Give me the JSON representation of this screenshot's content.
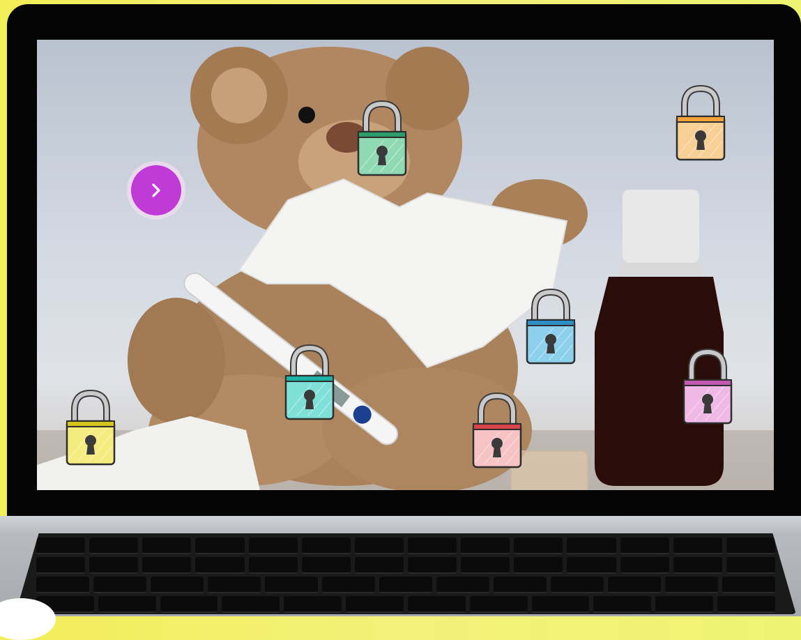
{
  "next_button": {
    "icon": "chevron-right-icon",
    "color": "#c03ad8"
  },
  "locks": [
    {
      "id": "green",
      "body_color": "#8fd9b3",
      "band_color": "#2e9c6a",
      "icon": "padlock-icon"
    },
    {
      "id": "orange",
      "body_color": "#f8cf94",
      "band_color": "#f0a23c",
      "icon": "padlock-icon"
    },
    {
      "id": "blue",
      "body_color": "#8dd0ee",
      "band_color": "#2d8fc4",
      "icon": "padlock-icon"
    },
    {
      "id": "cyan",
      "body_color": "#7fe0d8",
      "band_color": "#1fb0a6",
      "icon": "padlock-icon"
    },
    {
      "id": "pink",
      "body_color": "#f0b8e4",
      "band_color": "#c25bb0",
      "icon": "padlock-icon"
    },
    {
      "id": "yellow",
      "body_color": "#f4ec7e",
      "band_color": "#d4c41c",
      "icon": "padlock-icon"
    },
    {
      "id": "red",
      "body_color": "#f7c2c4",
      "band_color": "#d9434c",
      "icon": "padlock-icon"
    }
  ]
}
